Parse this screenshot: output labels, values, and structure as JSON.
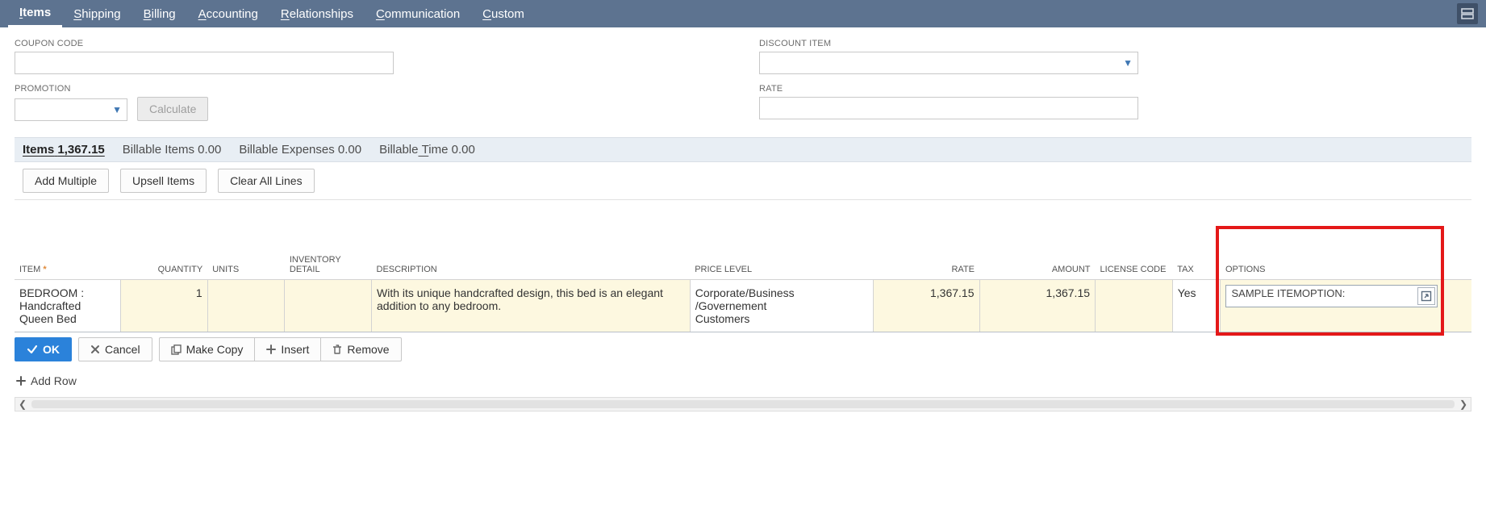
{
  "tabs": {
    "items": [
      {
        "label": "Items",
        "accesskey": "I"
      },
      {
        "label": "Shipping",
        "accesskey": "S"
      },
      {
        "label": "Billing",
        "accesskey": "B"
      },
      {
        "label": "Accounting",
        "accesskey": "A"
      },
      {
        "label": "Relationships",
        "accesskey": "R"
      },
      {
        "label": "Communication",
        "accesskey": "C"
      },
      {
        "label": "Custom",
        "accesskey": "C"
      }
    ]
  },
  "form": {
    "coupon_label": "COUPON CODE",
    "coupon_value": "",
    "discount_label": "DISCOUNT ITEM",
    "discount_value": "",
    "promotion_label": "PROMOTION",
    "promotion_value": "",
    "calculate_label": "Calculate",
    "rate_label": "RATE",
    "rate_value": ""
  },
  "subtabs": {
    "items": {
      "label": "Items",
      "amount": "1,367.15"
    },
    "billable_items": {
      "label": "Billable Items",
      "amount": "0.00"
    },
    "billable_expenses": {
      "label": "Billable Expenses",
      "amount": "0.00"
    },
    "billable_time": {
      "label": "Billable Time",
      "amount": "0.00"
    }
  },
  "list_actions": {
    "add_multiple": "Add Multiple",
    "upsell": "Upsell Items",
    "clear": "Clear All Lines"
  },
  "columns": {
    "item": "ITEM",
    "quantity": "QUANTITY",
    "units": "UNITS",
    "inventory_detail": "INVENTORY DETAIL",
    "description": "DESCRIPTION",
    "price_level": "PRICE LEVEL",
    "rate": "RATE",
    "amount": "AMOUNT",
    "license_code": "LICENSE CODE",
    "tax": "TAX",
    "options": "OPTIONS"
  },
  "rows": [
    {
      "item": "BEDROOM : Handcrafted Queen Bed",
      "quantity": "1",
      "units": "",
      "inventory_detail": "",
      "description": "With its unique handcrafted design, this bed is an elegant addition to any bedroom.",
      "price_level": "Corporate/Business/Governement Customers",
      "rate": "1,367.15",
      "amount": "1,367.15",
      "license_code": "",
      "tax": "Yes",
      "options": "SAMPLE ITEMOPTION:"
    }
  ],
  "row_actions": {
    "ok": "OK",
    "cancel": "Cancel",
    "make_copy": "Make Copy",
    "insert": "Insert",
    "remove": "Remove"
  },
  "add_row": "Add Row",
  "icons": {
    "check": "check-icon",
    "close": "close-icon",
    "copy": "copy-icon",
    "plus": "plus-icon",
    "trash": "trash-icon",
    "add": "plus-icon",
    "expand": "expand-icon",
    "panel": "panel-icon",
    "chevdown": "chevron-down-icon"
  }
}
